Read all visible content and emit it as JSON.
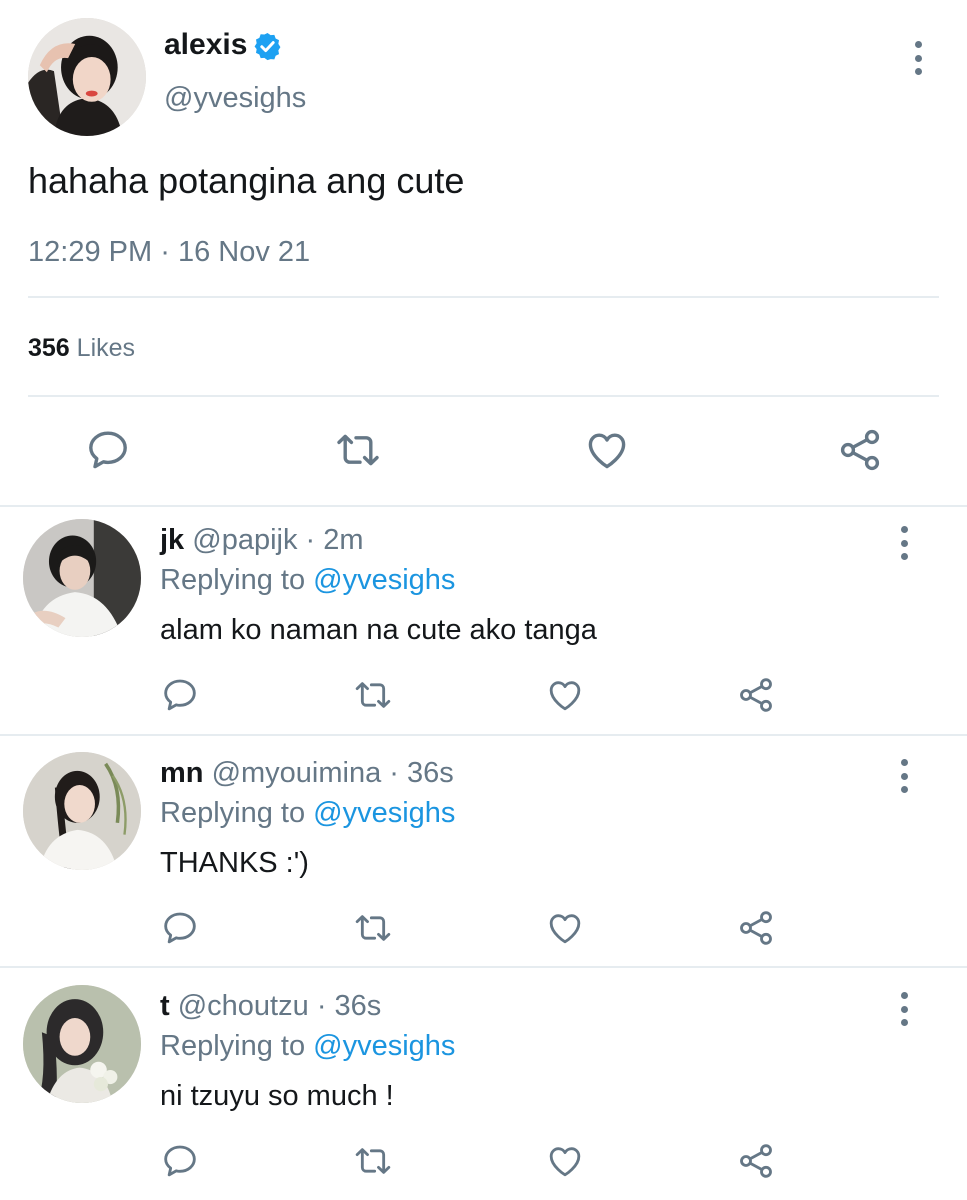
{
  "tweet": {
    "author_name": "alexis",
    "author_handle": "@yvesighs",
    "text": "hahaha potangina ang cute",
    "time": "12:29 PM",
    "separator": "·",
    "date": "16 Nov 21",
    "likes_count": "356",
    "likes_label": "Likes",
    "verified": true
  },
  "replies": [
    {
      "name": "jk",
      "handle": "@papijk",
      "time": "2m",
      "replying_label": "Replying to",
      "replying_to": "@yvesighs",
      "text": "alam ko naman na cute ako tanga"
    },
    {
      "name": "mn",
      "handle": "@myouimina",
      "time": "36s",
      "replying_label": "Replying to",
      "replying_to": "@yvesighs",
      "text": "THANKS :')"
    },
    {
      "name": "t",
      "handle": "@choutzu",
      "time": "36s",
      "replying_label": "Replying to",
      "replying_to": "@yvesighs",
      "text": "ni tzuyu so much !"
    }
  ],
  "icons": {
    "reply": "reply-icon",
    "retweet": "retweet-icon",
    "like": "heart-icon",
    "share": "share-icon",
    "more": "more-vertical-icon",
    "verified": "verified-badge-icon"
  },
  "colors": {
    "text": "#14171a",
    "muted": "#657786",
    "link": "#1b95e0",
    "verified": "#1da1f2",
    "divider": "#e6ecf0"
  }
}
